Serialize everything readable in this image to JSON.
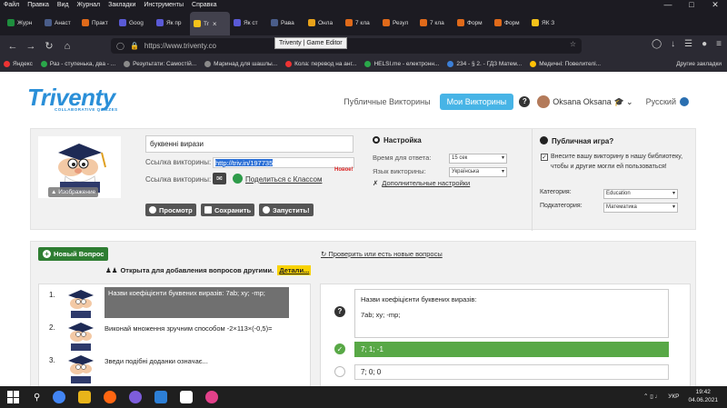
{
  "menubar": {
    "items": [
      "Файл",
      "Правка",
      "Вид",
      "Журнал",
      "Закладки",
      "Инструменты",
      "Справка"
    ]
  },
  "tabs": [
    {
      "label": "Журн",
      "color": "#1e8e3e"
    },
    {
      "label": "Анаст",
      "color": "#4a5d8a"
    },
    {
      "label": "Практ",
      "color": "#e06a1a"
    },
    {
      "label": "Goog",
      "color": "#5a5ad6"
    },
    {
      "label": "Як пр",
      "color": "#5a5ad6"
    },
    {
      "label": "Tr",
      "color": "#f4c21a",
      "active": true
    },
    {
      "label": "Як ст",
      "color": "#5a5ad6"
    },
    {
      "label": "Рава",
      "color": "#4a5d8a"
    },
    {
      "label": "Онла",
      "color": "#e8a21a"
    },
    {
      "label": "7 кла",
      "color": "#e06a1a"
    },
    {
      "label": "Резул",
      "color": "#e06a1a"
    },
    {
      "label": "7 кла",
      "color": "#e06a1a"
    },
    {
      "label": "Форм",
      "color": "#e06a1a"
    },
    {
      "label": "Форм",
      "color": "#e06a1a"
    },
    {
      "label": "ЯК З",
      "color": "#f4c21a"
    }
  ],
  "url": {
    "text": "https://www.triventy.co",
    "text_tail": "97735",
    "tooltip": "Triventy | Game Editor"
  },
  "bookmarks": [
    "Яндекс",
    "Раз - ступенька, два - ...",
    "Результати: Самостій...",
    "Маринад для шашлы...",
    "Кола: перевод на анг...",
    "HELSI.me - електронн...",
    "234 - § 2. - ГДЗ Матем...",
    "Медичні: Повелителі..."
  ],
  "bookmarks_other": "Другие закладки",
  "site": {
    "logo": "Triventy",
    "logo_sub": "COLLABORATIVE QUIZZES",
    "nav_public": "Публичные Викторины",
    "nav_my": "Мои Викторины",
    "help": "?",
    "user_name": "Oksana Oksana",
    "language": "Русский"
  },
  "quiz": {
    "image_button": "Изображение",
    "title": "буквенні вирази",
    "link_label": "Ссылка викторины:",
    "link_url": "http://triv.in/197735",
    "link2_label": "Ссылка викторины:",
    "share_link": "Поделиться с Классом",
    "new_badge": "Новое!",
    "btn_preview": "Просмотр",
    "btn_save": "Сохранить",
    "btn_start": "Запустить!"
  },
  "settings": {
    "title": "Настройка",
    "time_label": "Время для ответа:",
    "time_value": "15 сек",
    "lang_label": "Язык викторины:",
    "lang_value": "Українська",
    "advanced": "Дополнительные настройки"
  },
  "public_game": {
    "title": "Публичная игра?",
    "checkbox_text": "Внесите вашу викторину в нашу библиотеку, чтобы и другие могли ей пользоваться!",
    "category_label": "Категория:",
    "category_value": "Education",
    "subcategory_label": "Подкатегория:",
    "subcategory_value": "Математика"
  },
  "editor": {
    "new_question": "Новый Вопрос",
    "refresh": "Проверить или есть новые вопросы",
    "open_text": "Открыта для добавления вопросов другими.",
    "details": "Детали...",
    "questions": [
      {
        "num": "1.",
        "text": "Назви коефіцієнти буквених виразів: 7ab; xy; -mp;"
      },
      {
        "num": "2.",
        "text": "Виконай множення зручним способом -2×113×(-0,5)="
      },
      {
        "num": "3.",
        "text": "Зведи подібні доданки означає..."
      }
    ],
    "detail_question": "Назви коефіцієнти буквених виразів:",
    "detail_question_2": "7ab; xy; -mp;",
    "answers": [
      "7; 1; -1",
      "7; 0; 0"
    ]
  },
  "taskbar": {
    "lang": "УКР",
    "time": "19:42",
    "date": "04.06.2021"
  }
}
